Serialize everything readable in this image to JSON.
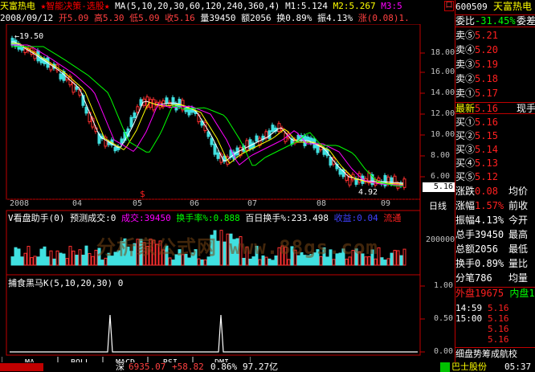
{
  "title": {
    "stock_name": "天富热电",
    "formula": "★智能决策-选股★",
    "ma_label": "MA(5,10,20,30,60,120,240,360,4)",
    "m1": "M1:5.124",
    "m2": "M2:5.267",
    "m3": "M3:5",
    "right_btn": "口"
  },
  "info": {
    "date": "2008/09/12",
    "open": "开5.09",
    "high": "高5.30",
    "low": "低5.09",
    "close": "收5.16",
    "volume": "量39450",
    "amount": "额2056",
    "turnover": "换0.89%",
    "amplitude": "振4.13%",
    "change": "涨(0.08)1."
  },
  "price_axis": [
    "18.00",
    "16.00",
    "14.00",
    "12.00",
    "10.00",
    "8.00",
    "6.00"
  ],
  "price_high_label": "19.50",
  "price_low_label": "4.92",
  "current_price": "5.16",
  "date_axis": [
    "2008",
    "04",
    "05",
    "06",
    "07",
    "08",
    "09"
  ],
  "period_label": "日线",
  "sell_marker": "$",
  "volume_panel": {
    "title": "V看盘助手(0)",
    "forecast": "预测成交:0",
    "volume": "成交:39450",
    "turnover": "换手率%:0.888",
    "hundred_day": "百日换手%:233.498",
    "profit": "收益:0.04",
    "flow": "流通",
    "axis": "200000"
  },
  "indicator_panel": {
    "title": "捕食黑马K(5,10,20,30)",
    "value": "0",
    "axis": [
      "1.00",
      "0.50",
      "0.00"
    ]
  },
  "tabs": [
    "MA",
    "BOLL",
    "MACD",
    "RSI",
    "DMI"
  ],
  "status": {
    "index_name": "深",
    "index_value": "6935.07",
    "index_change": "+58.82",
    "index_pct": "0.86%",
    "index_amount": "97.27亿",
    "ticker": "巴士股份",
    "time": "05:37"
  },
  "right_panel": {
    "code": "600509",
    "name": "天富热电",
    "weibi": "委比",
    "weibi_val": "-31.45%",
    "weicha": "委差",
    "sells": [
      {
        "label": "卖⑤",
        "price": "5.21"
      },
      {
        "label": "卖④",
        "price": "5.20"
      },
      {
        "label": "卖③",
        "price": "5.19"
      },
      {
        "label": "卖②",
        "price": "5.18"
      },
      {
        "label": "卖①",
        "price": "5.17"
      }
    ],
    "latest_label": "最新",
    "latest_price": "5.16",
    "latest_extra": "现手",
    "buys": [
      {
        "label": "买①",
        "price": "5.16"
      },
      {
        "label": "买②",
        "price": "5.15"
      },
      {
        "label": "买③",
        "price": "5.14"
      },
      {
        "label": "买④",
        "price": "5.13"
      },
      {
        "label": "买⑤",
        "price": "5.12"
      }
    ],
    "stats": [
      {
        "k": "涨跌",
        "v": "0.08",
        "k2": "均价"
      },
      {
        "k": "涨幅",
        "v": "1.57%",
        "k2": "前收"
      },
      {
        "k": "振幅",
        "v": "4.13%",
        "k2": "今开"
      },
      {
        "k": "总手",
        "v": "39450",
        "k2": "最高"
      },
      {
        "k": "总额",
        "v": "2056",
        "k2": "最低"
      },
      {
        "k": "换手",
        "v": "0.89%",
        "k2": "量比"
      },
      {
        "k": "分笔",
        "v": "786",
        "k2": "均量"
      }
    ],
    "outer": "外盘19675",
    "inner": "内盘1",
    "ticks": [
      {
        "t": "14:59",
        "p": "5.16"
      },
      {
        "t": "15:00",
        "p": "5.16"
      },
      {
        "t": "",
        "p": "5.16"
      },
      {
        "t": "",
        "p": "5.16"
      }
    ],
    "bottom_tabs": "细盘势筹成航校"
  },
  "watermark": "分析家公式网 www.88gs.com"
}
